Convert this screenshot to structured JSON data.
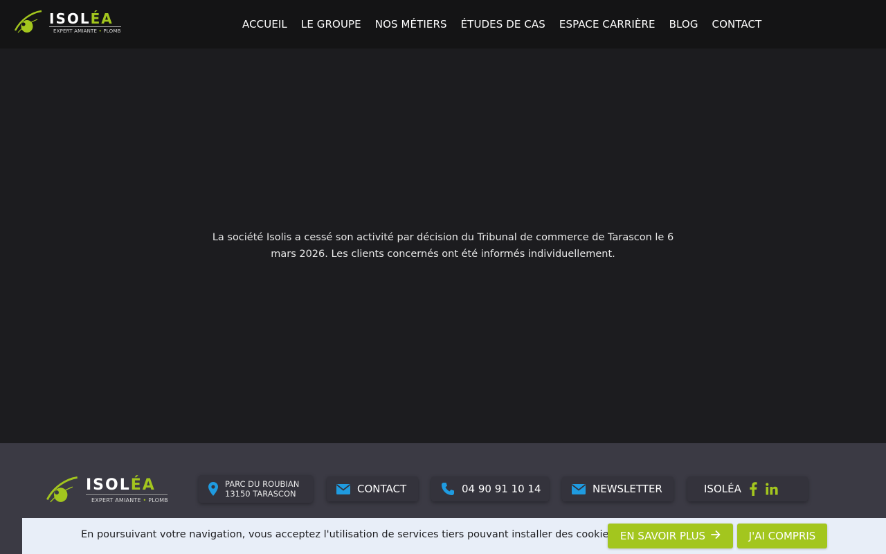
{
  "brand": {
    "name_main": "ISOL",
    "name_accent": "ÉA",
    "tagline_left": "EXPERT AMIANTE",
    "tagline_sep": "•",
    "tagline_right": "PLOMB"
  },
  "nav": {
    "items": [
      {
        "label": "ACCUEIL"
      },
      {
        "label": "LE GROUPE"
      },
      {
        "label": "NOS MÉTIERS"
      },
      {
        "label": "ÉTUDES DE CAS"
      },
      {
        "label": "ESPACE CARRIÈRE"
      },
      {
        "label": "BLOG"
      },
      {
        "label": "CONTACT"
      }
    ]
  },
  "main": {
    "notice": "La société Isolis a cessé son activité par décision du Tribunal de commerce de Tarascon le 6 mars 2026. Les clients concernés ont été informés individuellement."
  },
  "footer": {
    "address_line1": "PARC DU ROUBIAN",
    "address_line2": "13150 TARASCON",
    "contact_label": "CONTACT",
    "phone": "04 90 91 10 14",
    "newsletter_label": "NEWSLETTER",
    "social_label": "ISOLÉA",
    "icons": {
      "address": "map-pin-icon",
      "contact": "envelope-icon",
      "phone": "phone-icon",
      "newsletter": "envelope-icon",
      "facebook": "facebook-icon",
      "linkedin": "linkedin-icon"
    }
  },
  "cookie": {
    "text": "En poursuivant votre navigation, vous acceptez l'utilisation de services tiers pouvant installer des cookies",
    "more_label": "EN SAVOIR PLUS",
    "ok_label": "J'AI COMPRIS"
  },
  "colors": {
    "accent": "#a3c61e",
    "icon_blue": "#1f9be0",
    "header_bg": "#141415",
    "main_bg": "#1c1c1f",
    "footer_bg": "#3b3a44",
    "cookie_bg": "#e8eef8"
  }
}
